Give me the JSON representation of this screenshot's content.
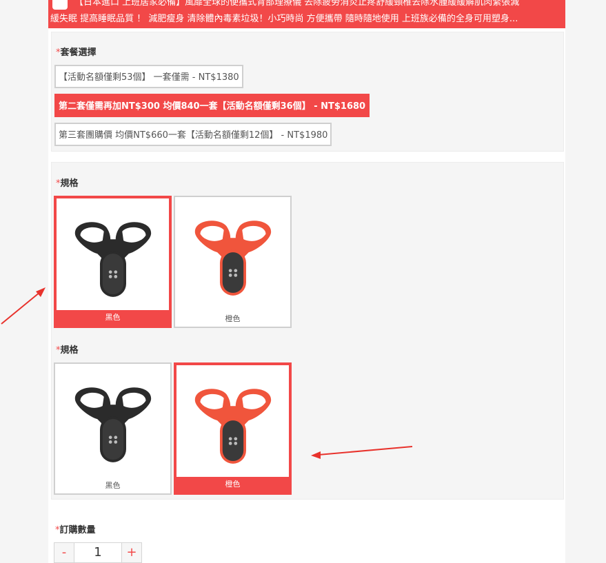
{
  "banner": {
    "line1": "【日本進口 上班居家必備】風靡全球的便攜式背部理療儀 去除疲勞消炎止疼舒緩頸椎去除水腫緩緩解肌肉緊張減",
    "line2": "緩失眠 提高睡眠品質 ！ 減肥瘦身 清除體內毒素垃圾！小巧時尚 方便攜帶 隨時隨地使用 上班族必備的全身可用塑身..."
  },
  "package": {
    "required_mark": "*",
    "title": "套餐選擇",
    "options": [
      {
        "label": "【活動名額僅剩53個】 一套僅需 - NT$1380",
        "selected": false
      },
      {
        "label": "第二套僅需再加NT$300 均價840一套【活動名額僅剩36個】 - NT$1680",
        "selected": true
      },
      {
        "label": "第三套團購價 均價NT$660一套【活動名額僅剩12個】 - NT$1980",
        "selected": false
      }
    ]
  },
  "specs": [
    {
      "required_mark": "*",
      "title": "規格",
      "items": [
        {
          "label": "黑色",
          "color": "#2b2b2b",
          "selected": true
        },
        {
          "label": "橙色",
          "color": "#f0553c",
          "selected": false
        }
      ]
    },
    {
      "required_mark": "*",
      "title": "規格",
      "items": [
        {
          "label": "黑色",
          "color": "#2b2b2b",
          "selected": false
        },
        {
          "label": "橙色",
          "color": "#f0553c",
          "selected": true
        }
      ]
    }
  ],
  "quantity": {
    "required_mark": "*",
    "title": "訂購數量",
    "minus": "-",
    "value": "1",
    "plus": "+"
  },
  "colors": {
    "accent": "#f24848",
    "device_black": "#2b2b2b",
    "device_orange": "#f0553c"
  }
}
